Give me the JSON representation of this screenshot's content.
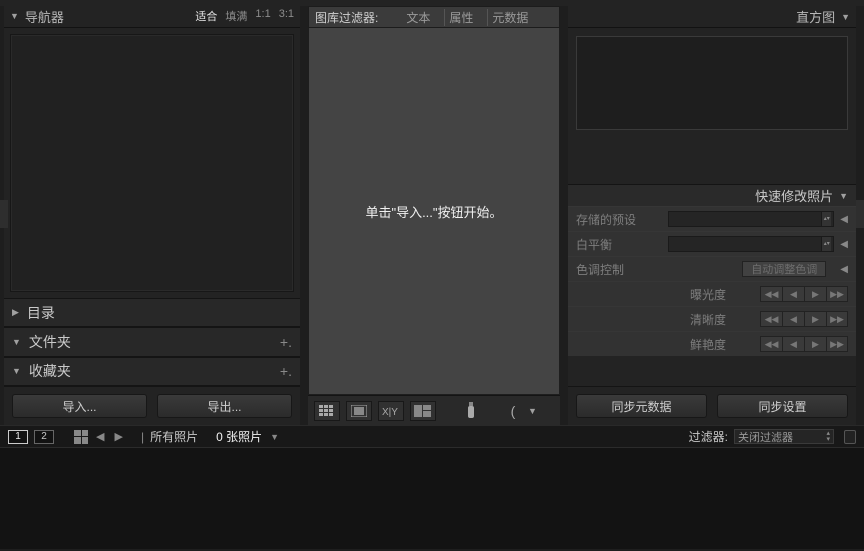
{
  "left": {
    "navigator": {
      "title": "导航器",
      "fit": "适合",
      "fill": "填满",
      "z1": "1:1",
      "z2": "3:1"
    },
    "catalog": "目录",
    "folders": "文件夹",
    "collections": "收藏夹",
    "import_btn": "导入...",
    "export_btn": "导出..."
  },
  "center": {
    "filter_label": "图库过滤器:",
    "f_text": "文本",
    "f_attr": "属性",
    "f_meta": "元数据",
    "hint": "单击\"导入...\"按钮开始。"
  },
  "right": {
    "histogram": "直方图",
    "quick_edit": "快速修改照片",
    "preset": "存储的预设",
    "wb": "白平衡",
    "tone": "色调控制",
    "auto": "自动调整色调",
    "exposure": "曝光度",
    "clarity": "清晰度",
    "vibrance": "鲜艳度",
    "sync_meta": "同步元数据",
    "sync_settings": "同步设置"
  },
  "bottom": {
    "mon1": "1",
    "mon2": "2",
    "crumb": "所有照片",
    "count": "0 张照片",
    "filter_label": "过滤器:",
    "filter_value": "关闭过滤器"
  }
}
